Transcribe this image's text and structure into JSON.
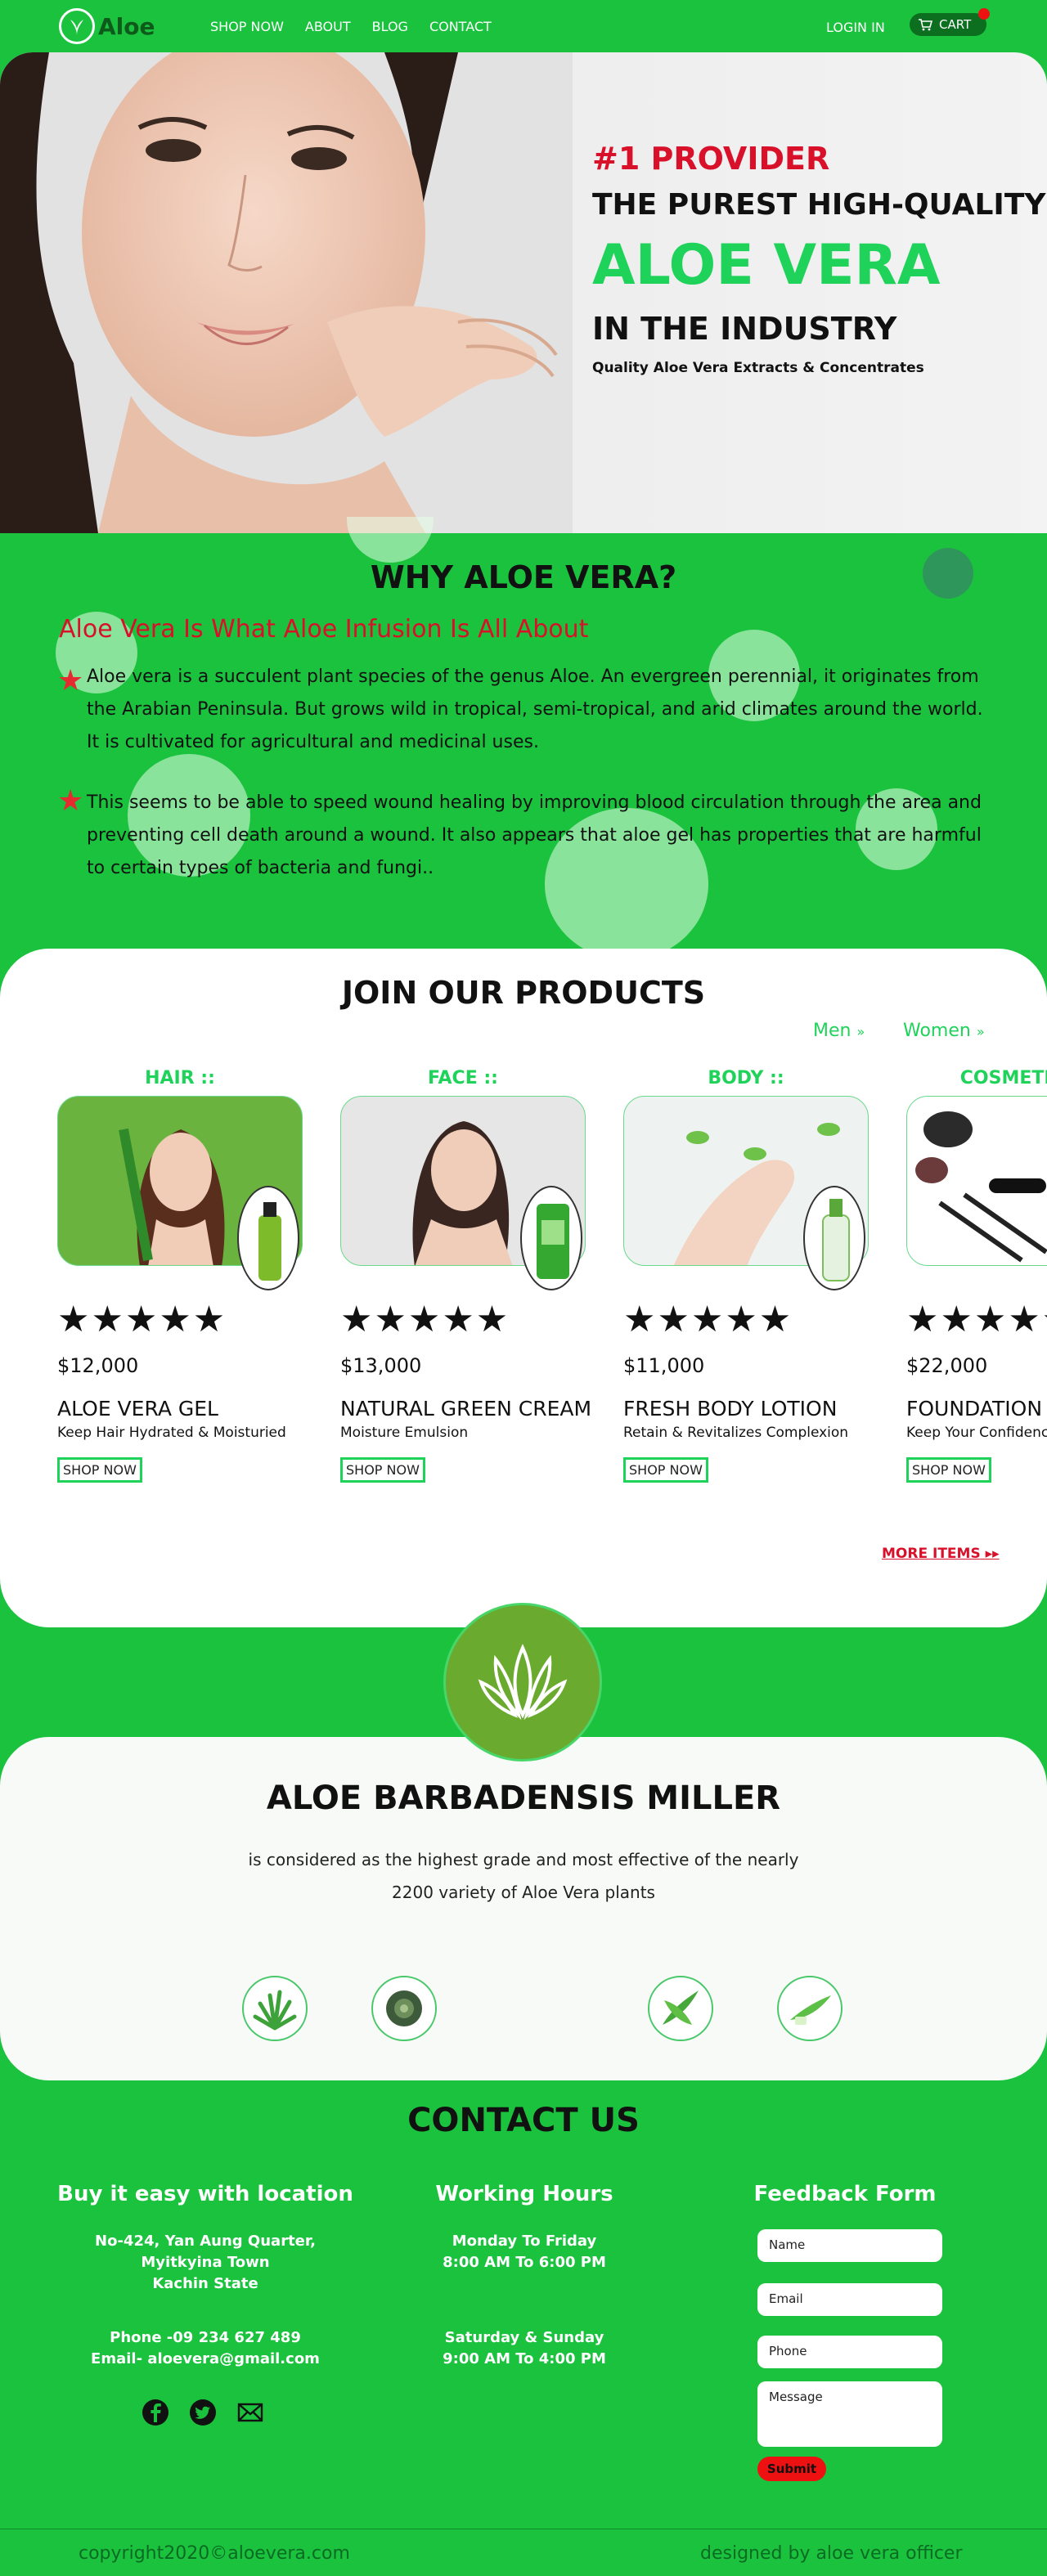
{
  "nav": {
    "logo_text": "Aloe",
    "links": [
      "SHOP NOW",
      "ABOUT",
      "BLOG",
      "CONTACT"
    ],
    "login": "LOGIN IN",
    "cart": "CART"
  },
  "hero": {
    "provider": "#1 PROVIDER",
    "purest": "THE PUREST HIGH-QUALITY",
    "aloe": "ALOE VERA",
    "industry": "IN THE INDUSTRY",
    "quality": "Quality Aloe Vera Extracts & Concentrates"
  },
  "why": {
    "title": "WHY ALOE VERA?",
    "subtitle": "Aloe Vera Is What Aloe Infusion Is All About",
    "p1": "Aloe vera is a succulent plant species of the genus Aloe. An evergreen perennial, it originates from the Arabian Peninsula. But grows wild in tropical, semi-tropical, and arid climates around the world. It is cultivated for agricultural and medicinal uses.",
    "p2": "This seems to be able to speed wound healing by improving blood circulation through the area and preventing cell death around a wound. It also appears that aloe gel has properties that are harmful to certain types of bacteria and fungi.."
  },
  "products": {
    "title": "JOIN OUR PRODUCTS",
    "filter_men": "Men",
    "filter_women": "Women",
    "shop_label": "SHOP NOW",
    "more": "MORE ITEMS",
    "stars": "★★★★★",
    "items": [
      {
        "category": "HAIR ::",
        "price": "$12,000",
        "name": "ALOE VERA GEL",
        "desc": "Keep Hair Hydrated & Moisturied"
      },
      {
        "category": "FACE ::",
        "price": "$13,000",
        "name": "NATURAL GREEN CREAM",
        "desc": "Moisture Emulsion"
      },
      {
        "category": "BODY ::",
        "price": "$11,000",
        "name": "FRESH BODY LOTION",
        "desc": "Retain & Revitalizes Complexion"
      },
      {
        "category": "COSMETICS ::",
        "price": "$22,000",
        "name": "FOUNDATION & MAKEUP",
        "desc": "Keep Your Confidence"
      }
    ]
  },
  "barb": {
    "title": "ALOE BARBADENSIS MILLER",
    "line1": "is considered as the highest grade and most effective of the nearly",
    "line2": "2200 variety of Aloe Vera plants"
  },
  "contact": {
    "title": "CONTACT US",
    "location_title": "Buy it easy with location",
    "address1": "No-424, Yan Aung Quarter,",
    "address2": "Myitkyina Town",
    "address3": "Kachin State",
    "phone": "Phone -09 234 627 489",
    "email": "Email- aloevera@gmail.com",
    "hours_title": "Working Hours",
    "weekday1": "Monday To Friday",
    "weekday2": "8:00 AM To 6:00 PM",
    "weekend1": "Saturday & Sunday",
    "weekend2": "9:00 AM To 4:00 PM",
    "form_title": "Feedback Form",
    "name_ph": "Name",
    "email_ph": "Email",
    "phone_ph": "Phone",
    "message_ph": "Message",
    "submit": "Submit"
  },
  "footer": {
    "copyright": "copyright2020©aloevera.com",
    "designed": "designed by aloe vera officer"
  }
}
